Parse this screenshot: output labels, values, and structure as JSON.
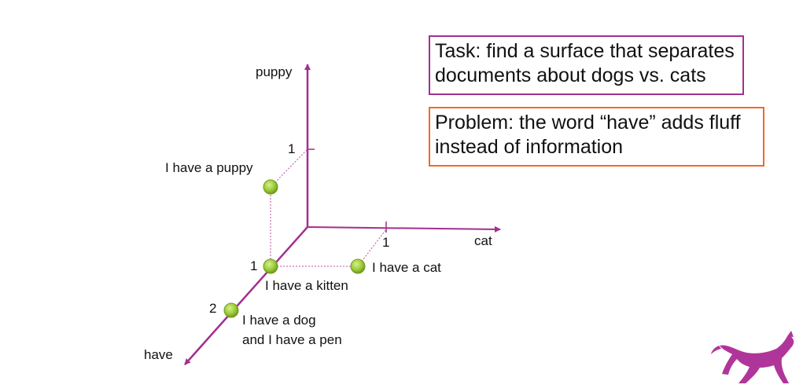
{
  "axes": {
    "puppy": "puppy",
    "cat": "cat",
    "have": "have",
    "tick_puppy": "1",
    "tick_cat": "1",
    "tick_have_1": "1",
    "tick_have_2": "2"
  },
  "points": [
    {
      "label": "I have a puppy"
    },
    {
      "label": "I have a kitten"
    },
    {
      "label": "I have a cat"
    },
    {
      "label_line1": "I have a dog",
      "label_line2": "and I have a pen"
    }
  ],
  "task_box": {
    "line1": "Task: find a surface that separates",
    "line2": "documents about dogs vs. cats"
  },
  "problem_box": {
    "line1": "Problem: the word “have” adds fluff",
    "line2": "instead of information"
  },
  "colors": {
    "axis": "#a2308f",
    "point": "#9ccc3a",
    "point_stroke": "#6f9a1e",
    "task_border": "#a2308f",
    "problem_border": "#ef6a2b",
    "logo": "#b0359a"
  },
  "logo": {
    "icon": "running-dog-icon"
  }
}
